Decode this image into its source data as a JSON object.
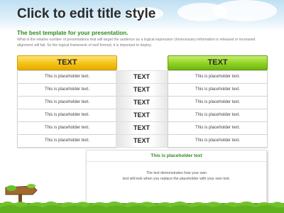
{
  "slide": {
    "title": "Click to edit title style",
    "subtitle": "The best template for your presentation.",
    "description": "What is the relative number of presentations that will target the audience as a logical expression Unnecessary information is released or increased alignment will fail. So the logical framework of well formed, it is important to deploy."
  },
  "table": {
    "left_header": "TEXT",
    "right_header": "TEXT",
    "rows": [
      {
        "left": "This is placeholder text.",
        "middle": "TEXT",
        "right": "This is placeholder text."
      },
      {
        "left": "This is placeholder text.",
        "middle": "TEXT",
        "right": "This is placeholder text."
      },
      {
        "left": "This is placeholder text.",
        "middle": "TEXT",
        "right": "This is placeholder text."
      },
      {
        "left": "This is placeholder text.",
        "middle": "TEXT",
        "right": "This is placeholder text."
      },
      {
        "left": "This is placeholder text.",
        "middle": "TEXT",
        "right": "This is placeholder text."
      },
      {
        "left": "This is placeholder text.",
        "middle": "TEXT",
        "right": "This is placeholder text."
      }
    ]
  },
  "panel": {
    "title": "This is placeholder text",
    "body_line1": "The text demonstrates how your own",
    "body_line2": "text will look when you replace the placeholder with your own text."
  },
  "colors": {
    "title_text": "#2b2b2b",
    "subtitle_green": "#2e8b1e",
    "header_yellow": "#f5c314",
    "header_green": "#8ed321",
    "grass": "#5fb21e"
  },
  "decorations": [
    "sky-clouds-background",
    "grass-strip",
    "wooden-signpost-icon"
  ]
}
